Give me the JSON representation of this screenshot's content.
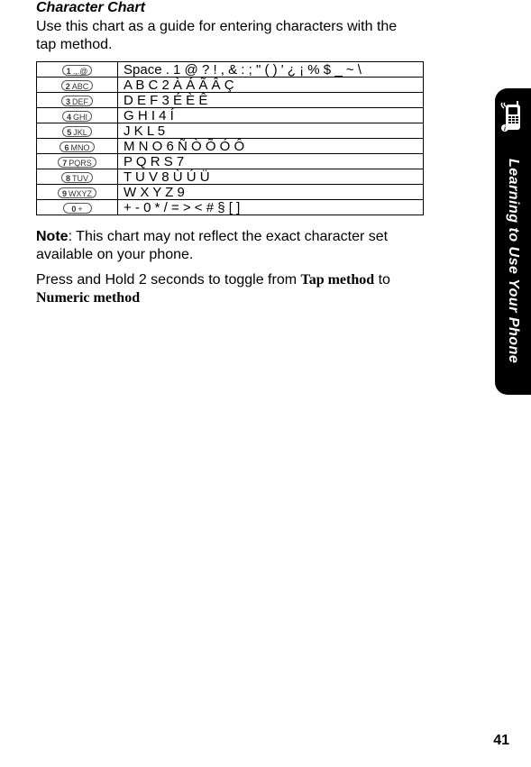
{
  "heading": "Character Chart",
  "intro": "Use this chart as a guide for entering characters with the tap method.",
  "table": {
    "rows": [
      {
        "key_digit": "1",
        "key_letters": ".,.@",
        "chars": "Space . 1 @ ? ! , & : ; \" ( ) ' ¿ ¡ % $ _ ~ \\"
      },
      {
        "key_digit": "2",
        "key_letters": "ABC",
        "chars": "A B C 2 À Á Ã Â Ç"
      },
      {
        "key_digit": "3",
        "key_letters": "DEF",
        "chars": "D E F 3 É È Ê"
      },
      {
        "key_digit": "4",
        "key_letters": "GHI",
        "chars": "G H I 4 Í"
      },
      {
        "key_digit": "5",
        "key_letters": "JKL",
        "chars": "J K L 5"
      },
      {
        "key_digit": "6",
        "key_letters": "MNO",
        "chars": "M N O 6 Ñ Ò Õ Ó Ô"
      },
      {
        "key_digit": "7",
        "key_letters": "PQRS",
        "chars": "P Q R S 7"
      },
      {
        "key_digit": "8",
        "key_letters": "TUV",
        "chars": "T U V 8 Ù Ú Ü"
      },
      {
        "key_digit": "9",
        "key_letters": "WXYZ",
        "chars": "W X Y Z 9"
      },
      {
        "key_digit": "0",
        "key_letters": "+",
        "chars": "+ - 0 * / = > < # § [ ]"
      }
    ]
  },
  "note_label": "Note",
  "note_text": ": This chart may not reflect the exact character set available on your phone.",
  "hold_pre": "Press and Hold 2 seconds to toggle from ",
  "hold_tap": "Tap method",
  "hold_mid": " to ",
  "hold_num": "Numeric method",
  "side_tab": "Learning to Use Your Phone",
  "page": "41"
}
